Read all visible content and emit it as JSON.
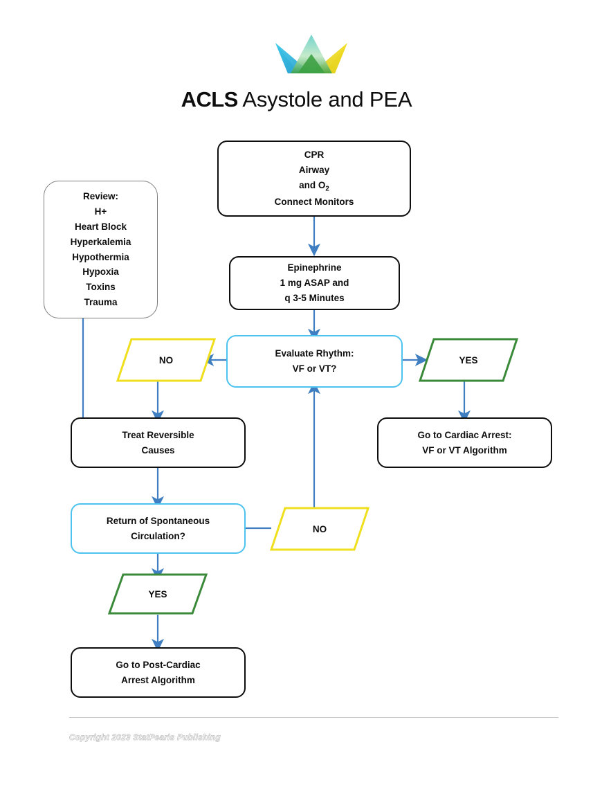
{
  "header": {
    "logo_name": "statpearls-crown-logo",
    "logo_colors": {
      "left": "#2ec4e8",
      "center": "#5ec8b8",
      "right": "#f2dc18",
      "overlap": "#2f9a36"
    },
    "title_bold": "ACLS",
    "title_regular": " Asystole and PEA"
  },
  "palette": {
    "arrow_blue": "#3f7fc1",
    "cyan": "#4cc3ee",
    "yellow": "#efdf1e",
    "green": "#3a8a3a",
    "black": "#0d0d0d",
    "gray": "#7d7d7d"
  },
  "nodes": {
    "cpr": {
      "type": "process",
      "border": "black",
      "lines": [
        "CPR",
        "Airway",
        "and O2",
        "Connect Monitors"
      ]
    },
    "review": {
      "type": "process",
      "border": "gray",
      "lines": [
        "Review:",
        "H+",
        "Heart Block",
        "Hyperkalemia",
        "Hypothermia",
        "Hypoxia",
        "Toxins",
        "Trauma"
      ]
    },
    "epinephrine": {
      "type": "process",
      "border": "black",
      "lines": [
        "Epinephrine",
        "1 mg ASAP and",
        "q 3-5 Minutes"
      ]
    },
    "evaluate_rhythm": {
      "type": "decision",
      "border": "cyan",
      "lines": [
        "Evaluate Rhythm:",
        "VF or VT?"
      ]
    },
    "no_rhythm": {
      "type": "parallelogram",
      "border": "yellow",
      "label": "NO"
    },
    "yes_rhythm": {
      "type": "parallelogram",
      "border": "green",
      "label": "YES"
    },
    "treat_reversible": {
      "type": "process",
      "border": "black",
      "lines": [
        "Treat Reversible",
        "Causes"
      ]
    },
    "cardiac_arrest": {
      "type": "process",
      "border": "black",
      "lines": [
        "Go to Cardiac Arrest:",
        "VF or VT Algorithm"
      ]
    },
    "rosc": {
      "type": "decision",
      "border": "cyan",
      "lines": [
        "Return of Spontaneous",
        "Circulation?"
      ]
    },
    "no_rosc": {
      "type": "parallelogram",
      "border": "yellow",
      "label": "NO"
    },
    "yes_rosc": {
      "type": "parallelogram",
      "border": "green",
      "label": "YES"
    },
    "post_cardiac": {
      "type": "process",
      "border": "black",
      "lines": [
        "Go to Post-Cardiac",
        "Arrest Algorithm"
      ]
    }
  },
  "footer": {
    "copyright": "Copyright 2023 StatPearls Publishing"
  }
}
